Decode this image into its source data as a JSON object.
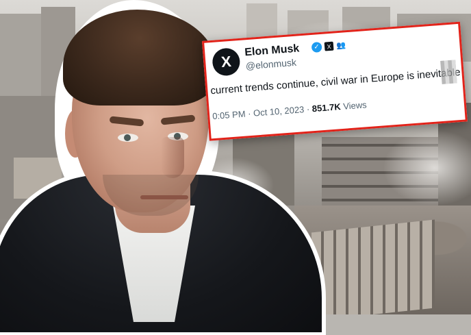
{
  "tweet": {
    "display_name": "Elon Musk",
    "handle": "@elonmusk",
    "text": "current trends continue, civil war in Europe is inevitable",
    "time": "0:05 PM · Oct 10, 2023 · ",
    "views_count": "851.7K",
    "views_label": " Views",
    "avatar_glyph": "X",
    "badges": {
      "verified": "blue-check-icon",
      "affiliate": "x-logo-icon",
      "group": "people-icon"
    },
    "accent_color": "#e2231a"
  }
}
